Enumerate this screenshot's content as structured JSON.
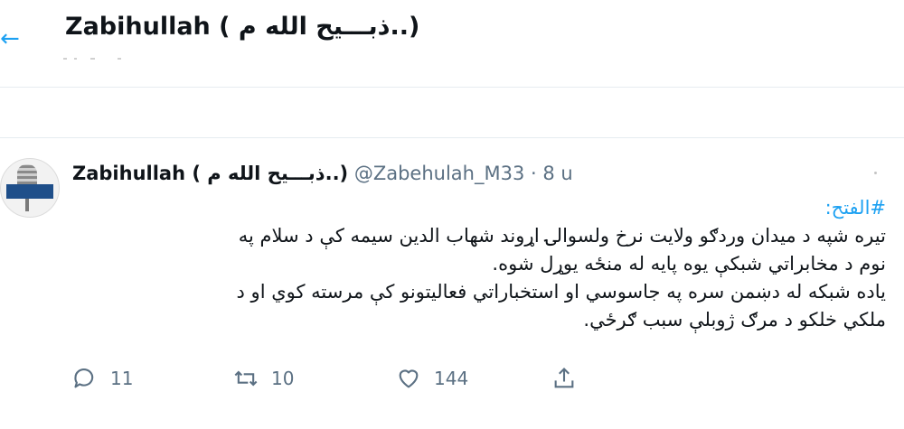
{
  "header": {
    "title": "Zabihullah ( ذبـــیح الله م..)"
  },
  "tweet": {
    "name": "Zabihullah ( ذبـــیح الله م..)",
    "handle": "@Zabehulah_M33",
    "separator": "·",
    "time": "8 u",
    "hashtag": "#الفتح:",
    "lines": [
      "تیره شپه د میدان وردګو ولایت نرخ ولسوالۍ اړوند شهاب الدين سيمه کې د سلام په",
      "نوم  د مخابراتي شبکې يوه پايه له منځه يوړل شوه.",
      "ياده شبکه له دښمن سره په جاسوسي او استخباراتي فعالیتونو کې مرسته کوي او د",
      "ملکي خلکو د مرګ ژوبلې سبب ګرځي."
    ],
    "actions": {
      "reply_count": "11",
      "retweet_count": "10",
      "like_count": "144"
    }
  },
  "colors": {
    "accent": "#1da1f2",
    "secondary_text": "#5b7083",
    "divider": "#e6ecf0"
  },
  "icons": [
    "back-arrow-icon",
    "reply-icon",
    "retweet-icon",
    "like-icon",
    "share-icon"
  ]
}
